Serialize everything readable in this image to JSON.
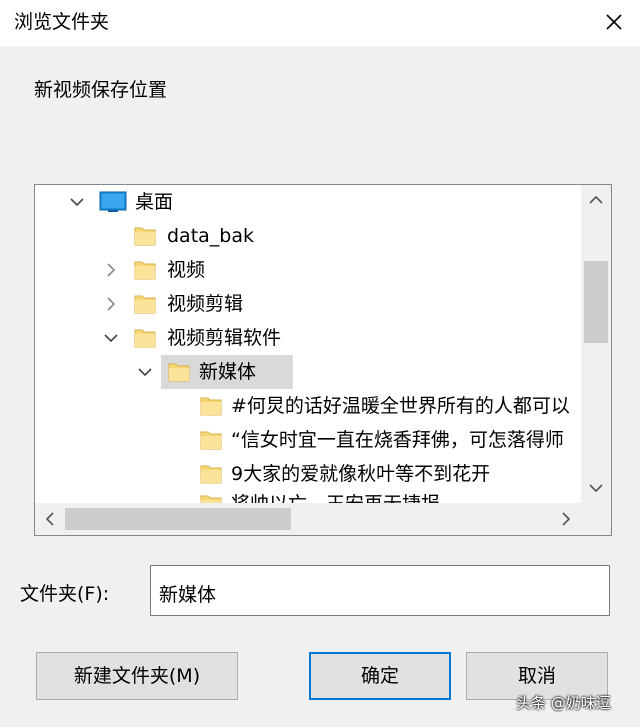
{
  "window": {
    "title": "浏览文件夹",
    "close_icon": "close-icon"
  },
  "dialog": {
    "prompt": "新视频保存位置"
  },
  "tree": {
    "nodes": [
      {
        "label": "桌面",
        "icon": "desktop-icon",
        "expander": "expanded"
      },
      {
        "label": "data_bak",
        "icon": "folder-icon",
        "expander": "none"
      },
      {
        "label": "视频",
        "icon": "folder-icon",
        "expander": "collapsed"
      },
      {
        "label": "视频剪辑",
        "icon": "folder-icon",
        "expander": "collapsed"
      },
      {
        "label": "视频剪辑软件",
        "icon": "folder-icon",
        "expander": "expanded"
      },
      {
        "label": "新媒体",
        "icon": "folder-icon",
        "expander": "expanded",
        "selected": true
      },
      {
        "label": "#何炅的话好温暖全世界所有的人都可以",
        "icon": "folder-icon",
        "expander": "none"
      },
      {
        "label": "“信女时宜一直在烧香拜佛，可怎落得师",
        "icon": "folder-icon",
        "expander": "none"
      },
      {
        "label": "9大家的爱就像秋叶等不到花开",
        "icon": "folder-icon",
        "expander": "none"
      },
      {
        "label": "将帅以亡，王安再无捷报",
        "icon": "folder-icon",
        "expander": "none"
      }
    ]
  },
  "folder_field": {
    "label": "文件夹(F):",
    "value": "新媒体"
  },
  "buttons": {
    "new_folder": "新建文件夹(M)",
    "ok": "确定",
    "cancel": "取消"
  },
  "watermark": "头条 @奶味逗",
  "colors": {
    "selection": "#d9d9d9",
    "folder": "#f8d775",
    "default_button_border": "#0078d7"
  }
}
